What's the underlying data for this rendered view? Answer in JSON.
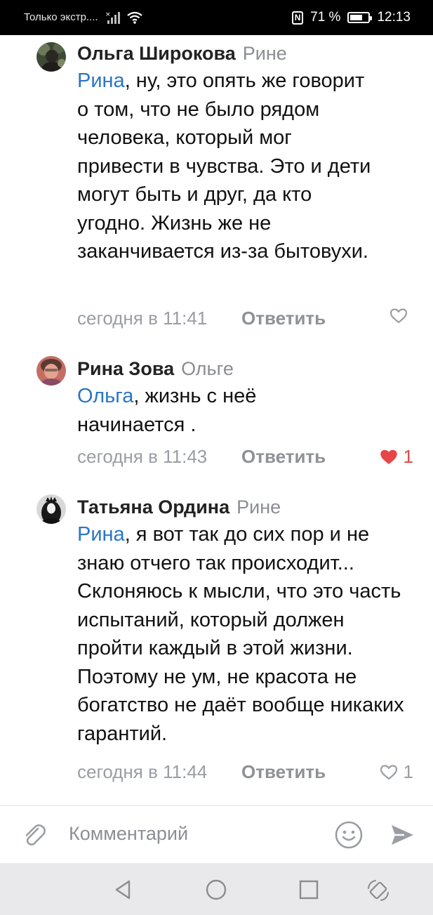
{
  "status_bar": {
    "carrier_text": "Только экстр....",
    "battery_percent_label": "71 %",
    "battery_level": 0.71,
    "time": "12:13",
    "nfc_label": "N"
  },
  "comments": [
    {
      "author": "Ольга Широкова",
      "reply_to": "Рине",
      "mention": "Рина",
      "text": ", ну, это опять же говорит о том, что не было рядом человека, который мог привести в чувства. Это и дети могут быть и друг, да кто угодно. Жизнь же не заканчивается из-за бытовухи.",
      "time": "сегодня в 11:41",
      "reply_label": "Ответить",
      "likes": "",
      "liked": false
    },
    {
      "author": "Рина Зова",
      "reply_to": "Ольге",
      "mention": "Ольга",
      "text": ", жизнь с неё начинается .",
      "time": "сегодня в 11:43",
      "reply_label": "Ответить",
      "likes": "1",
      "liked": true
    },
    {
      "author": "Татьяна Ордина",
      "reply_to": "Рине",
      "mention": "Рина",
      "text": ", я вот так до сих пор и не знаю отчего так происходит... Склоняюсь к мысли, что это часть испытаний, который должен пройти каждый в этой жизни. Поэтому не ум, не красота не богатство не даёт вообще никаких гарантий.",
      "time": "сегодня в 11:44",
      "reply_label": "Ответить",
      "likes": "1",
      "liked": false
    }
  ],
  "composer": {
    "placeholder": "Комментарий"
  },
  "colors": {
    "mention": "#2a76c6",
    "like_active": "#e64646",
    "muted": "#9a9da3"
  }
}
